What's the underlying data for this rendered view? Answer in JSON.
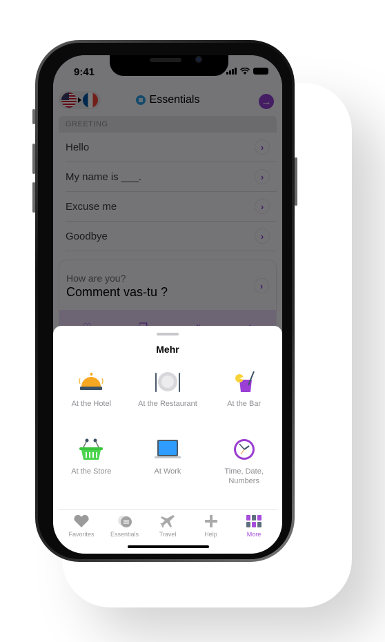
{
  "status_bar": {
    "time": "9:41"
  },
  "nav": {
    "source_flag": "us-flag",
    "target_flag": "fr-flag",
    "title": "Essentials",
    "next_icon": "arrow-right-icon"
  },
  "section": {
    "header": "GREETING"
  },
  "phrases": [
    {
      "label": "Hello"
    },
    {
      "label": "My name is ___."
    },
    {
      "label": "Excuse me"
    },
    {
      "label": "Goodbye"
    }
  ],
  "card": {
    "source": "How are you?",
    "translation": "Comment vas-tu ?",
    "actions": [
      "heart-icon",
      "copy-icon",
      "speaker-icon",
      "share-icon"
    ]
  },
  "sheet": {
    "title": "Mehr",
    "items": [
      {
        "label": "At the Hotel",
        "icon": "hotel-bell-icon"
      },
      {
        "label": "At the Restaurant",
        "icon": "plate-icon"
      },
      {
        "label": "At the Bar",
        "icon": "cocktail-icon"
      },
      {
        "label": "At the Store",
        "icon": "basket-icon"
      },
      {
        "label": "At Work",
        "icon": "laptop-icon"
      },
      {
        "label": "Time, Date, Numbers",
        "icon": "clock-icon"
      }
    ]
  },
  "tabbar": {
    "items": [
      {
        "label": "Favorites",
        "icon": "heart-icon"
      },
      {
        "label": "Essentials",
        "icon": "essentials-icon"
      },
      {
        "label": "Travel",
        "icon": "airplane-icon"
      },
      {
        "label": "Help",
        "icon": "plus-icon"
      },
      {
        "label": "More",
        "icon": "grid-icon",
        "active": true
      }
    ]
  },
  "colors": {
    "accent": "#8e3ecf",
    "active_tab": "#a64ddb"
  }
}
